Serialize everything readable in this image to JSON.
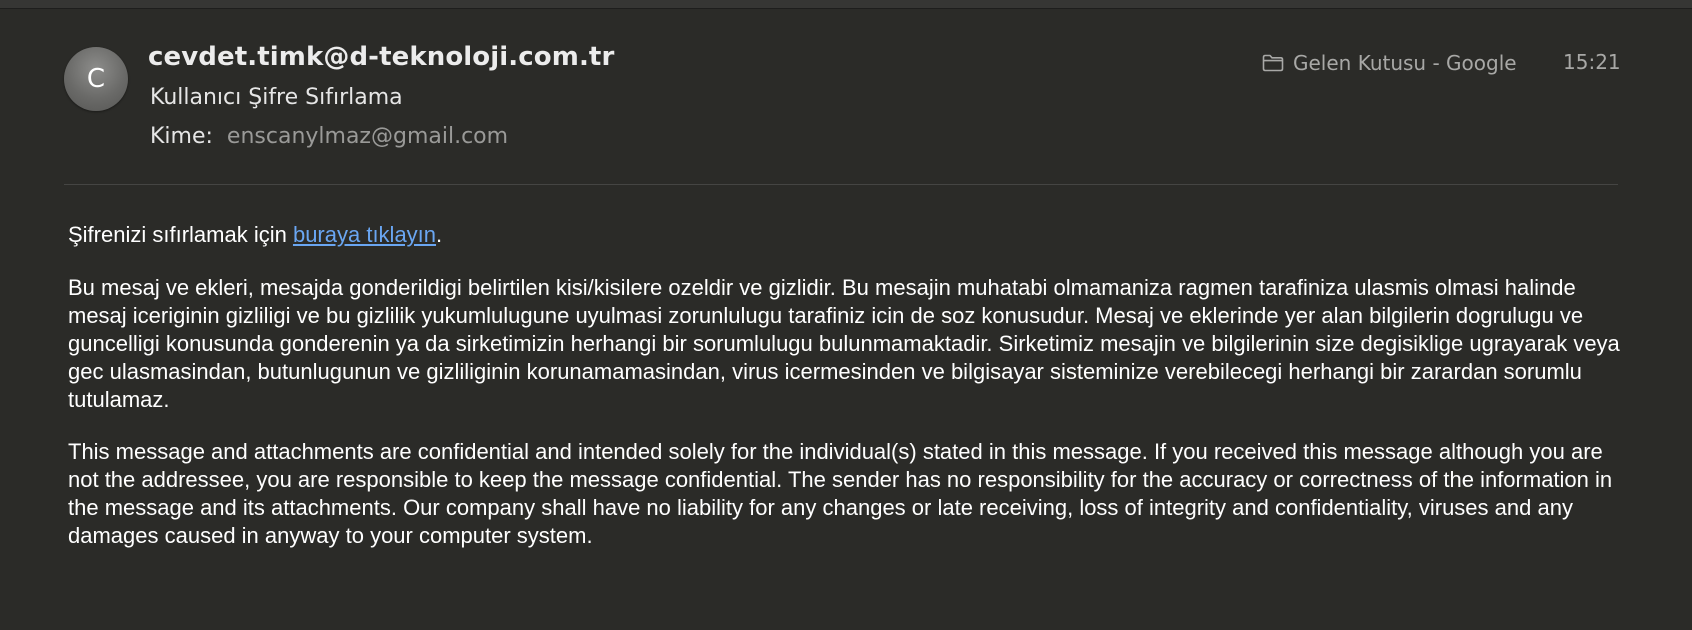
{
  "header": {
    "avatar_initial": "C",
    "sender": "cevdet.timk@d-teknoloji.com.tr",
    "subject": "Kullanıcı Şifre Sıfırlama",
    "to_label": "Kime:",
    "to_value": "enscanylmaz@gmail.com",
    "mailbox": "Gelen Kutusu - Google",
    "mailbox_icon": "folder-icon",
    "time": "15:21"
  },
  "message": {
    "reset_prefix": "Şifrenizi sıfırlamak için ",
    "reset_link": "buraya tıklayın",
    "reset_suffix": ".",
    "disclaimer_tr": "Bu mesaj ve ekleri, mesajda gonderildigi belirtilen kisi/kisilere ozeldir ve gizlidir. Bu mesajin muhatabi olmamaniza ragmen tarafiniza ulasmis olmasi halinde mesaj iceriginin gizliligi ve bu gizlilik yukumlulugune uyulmasi zorunlulugu tarafiniz icin de soz konusudur. Mesaj ve eklerinde yer alan bilgilerin dogrulugu ve guncelligi konusunda gonderenin ya da sirketimizin herhangi bir sorumlulugu bulunmamaktadir. Sirketimiz mesajin ve bilgilerinin size degisiklige ugrayarak veya gec ulasmasindan, butunlugunun ve gizliliginin korunamamasindan, virus icermesinden ve bilgisayar sisteminize verebilecegi herhangi bir zarardan sorumlu tutulamaz.",
    "disclaimer_en": "This message and attachments are confidential and intended solely for the individual(s) stated in this message. If you received this message although you are not the addressee, you are responsible to keep the message confidential. The sender has no responsibility for the accuracy or correctness of the information in the message and its attachments. Our company shall have no liability for any changes or late receiving, loss of integrity and confidentiality, viruses and any damages caused in anyway to your computer system."
  },
  "colors": {
    "background": "#2b2b28",
    "link": "#6aa6f2",
    "muted_text": "#a8a8a6"
  }
}
